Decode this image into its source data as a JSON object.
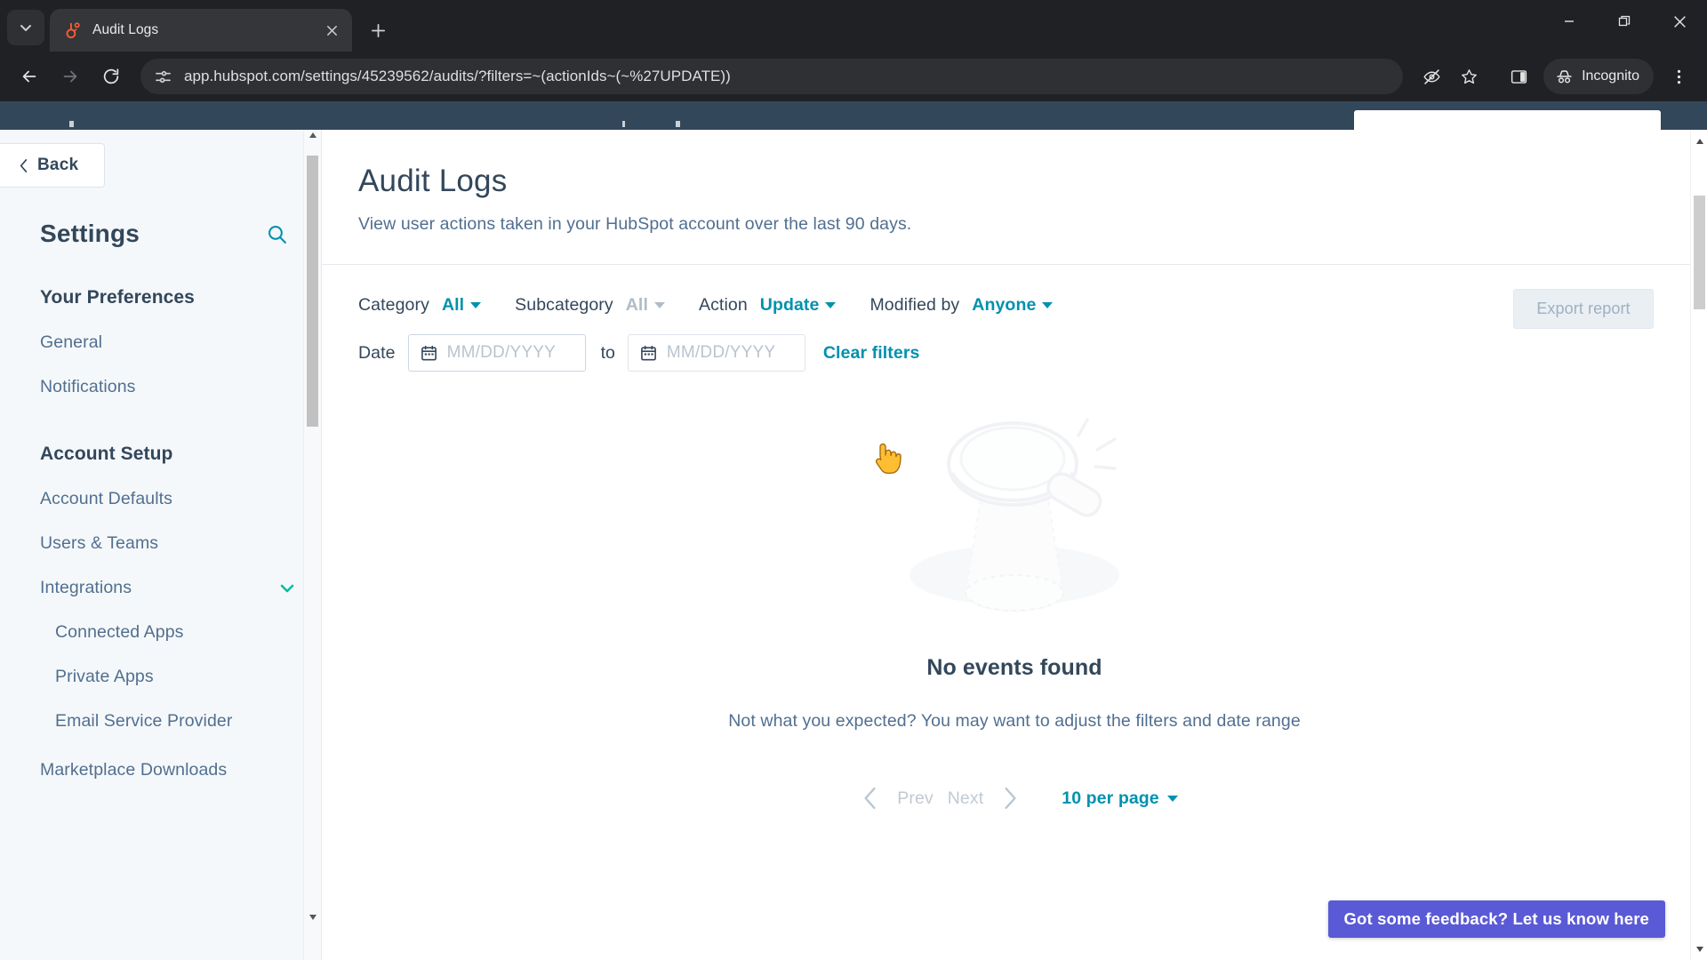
{
  "browser": {
    "tab": {
      "title": "Audit Logs",
      "favicon": "hubspot-sprocket-icon",
      "close_icon": "close-icon"
    },
    "tab_search_icon": "chevron-down-icon",
    "new_tab_icon": "plus-icon",
    "window_controls": {
      "minimize": "minimize-icon",
      "maximize": "restore-icon",
      "close": "close-icon"
    },
    "nav": {
      "back_icon": "arrow-left-icon",
      "forward_icon": "arrow-right-icon",
      "reload_icon": "reload-icon",
      "site_info_icon": "page-settings-icon",
      "url": "app.hubspot.com/settings/45239562/audits/?filters=~(actionIds~(~%27UPDATE))"
    },
    "toolbar": {
      "tracking_protection_icon": "eye-off-icon",
      "bookmark_icon": "star-icon",
      "side_panel_icon": "side-panel-icon",
      "incognito_label": "Incognito",
      "incognito_icon": "incognito-hat-icon",
      "menu_icon": "three-dot-menu-icon"
    }
  },
  "sidebar": {
    "back_label": "Back",
    "back_icon": "chevron-left-icon",
    "title": "Settings",
    "search_icon": "search-icon",
    "sections": [
      {
        "title": "Your Preferences",
        "items": [
          {
            "label": "General",
            "sub": false
          },
          {
            "label": "Notifications",
            "sub": false
          }
        ]
      },
      {
        "title": "Account Setup",
        "items": [
          {
            "label": "Account Defaults",
            "sub": false
          },
          {
            "label": "Users & Teams",
            "sub": false
          },
          {
            "label": "Integrations",
            "sub": false,
            "chevron": "chevron-down-icon"
          },
          {
            "label": "Connected Apps",
            "sub": true
          },
          {
            "label": "Private Apps",
            "sub": true
          },
          {
            "label": "Email Service Provider",
            "sub": true
          },
          {
            "label": "Marketplace Downloads",
            "sub": false
          }
        ]
      }
    ]
  },
  "page": {
    "title": "Audit Logs",
    "subtitle": "View user actions taken in your HubSpot account over the last 90 days.",
    "filters": {
      "category_label": "Category",
      "category_value": "All",
      "subcategory_label": "Subcategory",
      "subcategory_value": "All",
      "action_label": "Action",
      "action_value": "Update",
      "modified_by_label": "Modified by",
      "modified_by_value": "Anyone",
      "date_label": "Date",
      "date_from_placeholder": "MM/DD/YYYY",
      "date_to_placeholder": "MM/DD/YYYY",
      "to_label": "to",
      "clear_filters_label": "Clear filters",
      "calendar_icon": "calendar-icon",
      "caret_icon": "caret-down-icon"
    },
    "export_button_label": "Export report",
    "empty_state": {
      "illustration": "magnifying-glass-illustration",
      "title": "No events found",
      "subtitle": "Not what you expected? You may want to adjust the filters and date range"
    },
    "pagination": {
      "prev_label": "Prev",
      "next_label": "Next",
      "prev_icon": "chevron-left-icon",
      "next_icon": "chevron-right-icon",
      "per_page_label": "10 per page",
      "per_page_caret": "caret-down-icon"
    },
    "feedback_button_label": "Got some feedback? Let us know here"
  },
  "colors": {
    "hubspot_navy": "#33475b",
    "teal_link": "#0091ae",
    "teal_accent": "#00bda5",
    "feedback_purple": "#5a5ad6",
    "muted_text": "#516f90"
  }
}
